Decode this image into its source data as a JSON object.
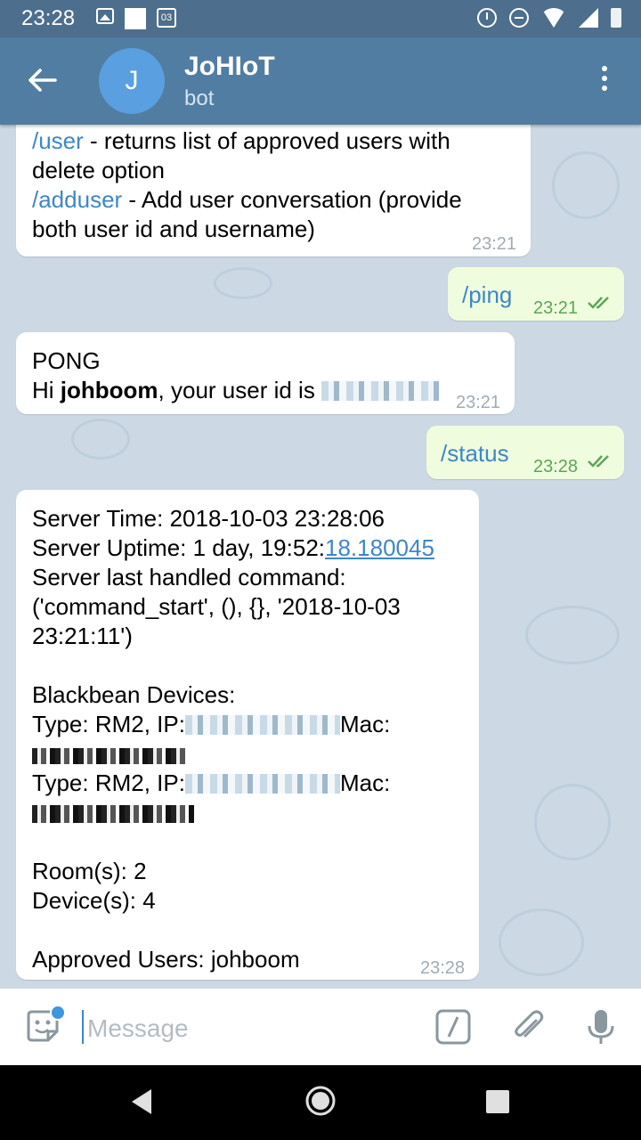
{
  "status_bar": {
    "time": "23:28",
    "calendar_day": "03"
  },
  "header": {
    "avatar_letter": "J",
    "title": "JoHIoT",
    "subtitle": "bot"
  },
  "messages": {
    "m1": {
      "cmd_user": "/user",
      "text_user": " - returns list of approved users with",
      "text_user2": "delete option",
      "cmd_adduser": "/adduser",
      "text_adduser": " - Add user conversation (provide",
      "text_adduser2": "both user id and username)",
      "time": "23:21"
    },
    "m2": {
      "text": "/ping",
      "time": "23:21"
    },
    "m3": {
      "line1": "PONG",
      "hi": "Hi ",
      "name": "johboom",
      "rest": ", your user id is ",
      "time": "23:21"
    },
    "m4": {
      "text": "/status",
      "time": "23:28"
    },
    "m5": {
      "l1": "Server Time: 2018-10-03 23:28:06",
      "l2a": "Server Uptime: 1 day, 19:52:",
      "l2b": "18.180045",
      "l3": "Server last handled command:",
      "l4": "('command_start', (), {}, '2018-10-03",
      "l5": "23:21:11')",
      "l6": "Blackbean Devices:",
      "l7a": "Type: RM2, IP:",
      "l7b": "Mac:",
      "l9a": "Type: RM2, IP:",
      "l9b": "Mac:",
      "l11": "Room(s): 2",
      "l12": "Device(s): 4",
      "l13": "Approved Users: johboom",
      "time": "23:28"
    }
  },
  "input": {
    "placeholder": "Message"
  },
  "colors": {
    "header": "#517da2",
    "status_bar": "#4d6e8c",
    "outgoing": "#effdde",
    "link": "#3d87c7"
  }
}
